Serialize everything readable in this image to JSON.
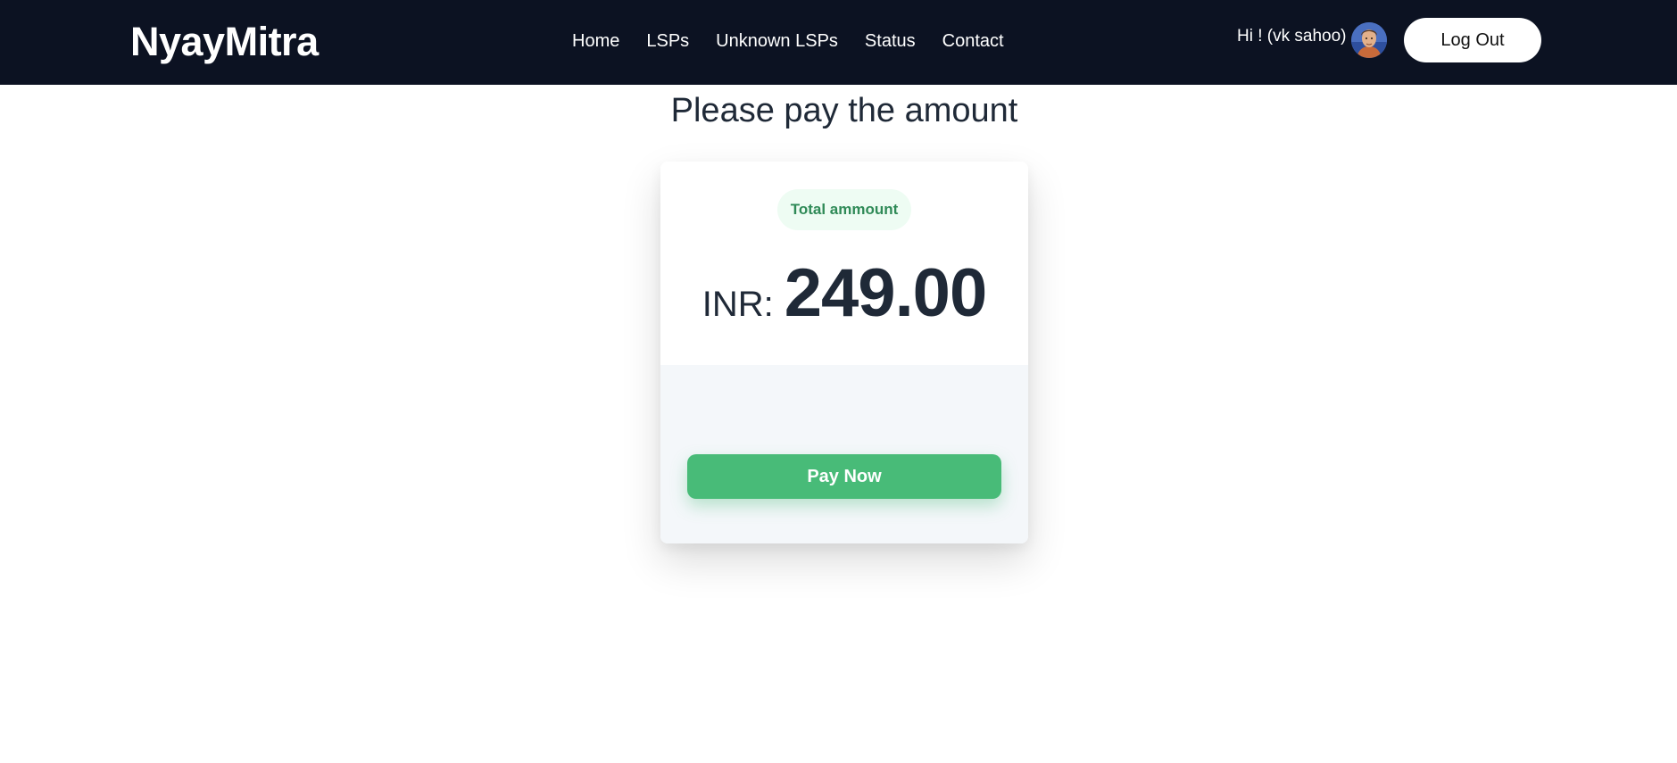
{
  "navbar": {
    "brand": "NyayMitra",
    "links": [
      {
        "label": "Home"
      },
      {
        "label": "LSPs"
      },
      {
        "label": "Unknown LSPs"
      },
      {
        "label": "Status"
      },
      {
        "label": "Contact"
      }
    ],
    "greeting": "Hi ! (vk sahoo)",
    "logout_label": "Log Out",
    "background_color": "#0c1222"
  },
  "main": {
    "title": "Please pay the amount",
    "card": {
      "badge": "Total ammount",
      "currency": "INR:",
      "amount": "249.00",
      "pay_label": "Pay Now",
      "accent_color": "#48bb78"
    }
  }
}
